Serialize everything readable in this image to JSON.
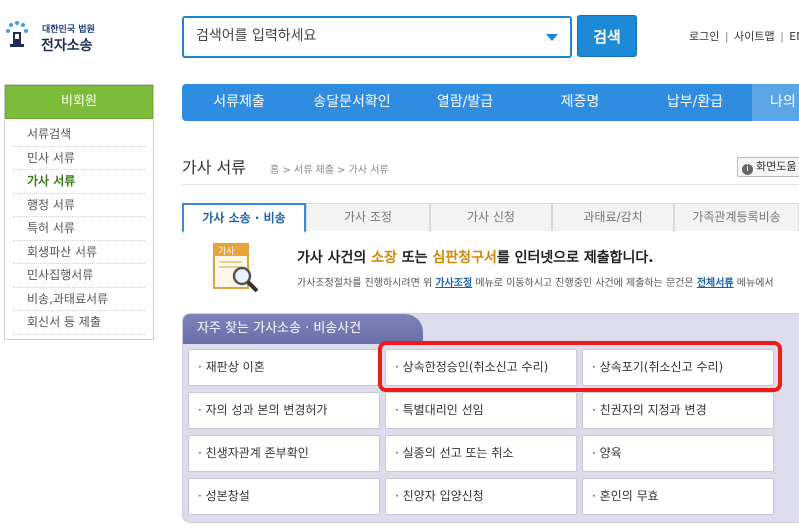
{
  "header": {
    "logo_small": "대한민국 법원",
    "logo_big": "전자소송",
    "search_placeholder": "검색어를 입력하세요",
    "search_button": "검색",
    "util_links": [
      "로그인",
      "사이트맵",
      "ENG"
    ]
  },
  "sidebar": {
    "header": "비회원",
    "items": [
      {
        "label": "서류검색",
        "active": false
      },
      {
        "label": "민사 서류",
        "active": false
      },
      {
        "label": "가사 서류",
        "active": true
      },
      {
        "label": "행정 서류",
        "active": false
      },
      {
        "label": "특허 서류",
        "active": false
      },
      {
        "label": "회생파산 서류",
        "active": false
      },
      {
        "label": "민사집행서류",
        "active": false
      },
      {
        "label": "비송,과태료서류",
        "active": false
      },
      {
        "label": "회신서 등 제출",
        "active": false
      }
    ]
  },
  "topnav": {
    "items": [
      "서류제출",
      "송달문서확인",
      "열람/발급",
      "제증명",
      "납부/환급",
      "나의"
    ]
  },
  "page": {
    "title": "가사 서류",
    "breadcrumb": "홈 > 서류 제출 > 가사 서류",
    "help_label": "화면도움"
  },
  "subtabs": [
    "가사 소송 · 비송",
    "가사 조정",
    "가사 신청",
    "과태료/감치",
    "가족관계등록비송"
  ],
  "intro": {
    "image_label": "가사",
    "title_a": "가사 사건의 ",
    "title_b": "소장",
    "title_c": " 또는 ",
    "title_d": "심판청구서",
    "title_e": "를 인터넷으로 제출합니다.",
    "desc_a": "가사조정절차를 진행하시려면 위 ",
    "desc_link1": "가사조정",
    "desc_b": " 메뉴로 이동하시고 진행중인 사건에 제출하는 문건은 ",
    "desc_link2": "전체서류",
    "desc_c": " 메뉴에서"
  },
  "faq": {
    "title": "자주 찾는 가사소송 · 비송사건",
    "items": [
      "· 재판상 이혼",
      "· 상속한정승인(취소신고 수리)",
      "· 상속포기(취소신고 수리)",
      "· 자의 성과 본의 변경허가",
      "· 특별대리인 선임",
      "· 친권자의 지정과 변경",
      "· 친생자관계 존부확인",
      "· 실종의 선고 또는 취소",
      "· 양육",
      "· 성본창설",
      "· 친양자 입양신청",
      "· 혼인의 무효"
    ]
  },
  "colors": {
    "brand_blue": "#2e8de0",
    "sidebar_green": "#7dbc3a",
    "faq_header": "#6b6fa9",
    "highlight_red": "#ef1a1a"
  }
}
